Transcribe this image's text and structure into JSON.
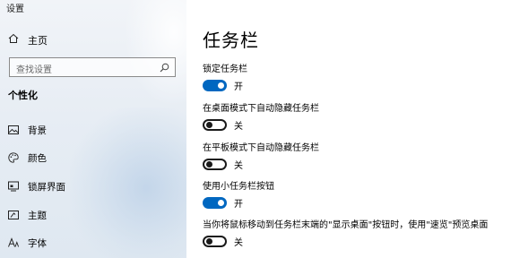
{
  "window": {
    "title": "设置"
  },
  "sidebar": {
    "home_label": "主页",
    "search_placeholder": "查找设置",
    "section_title": "个性化",
    "items": [
      {
        "label": "背景",
        "icon": "image-icon"
      },
      {
        "label": "颜色",
        "icon": "palette-icon"
      },
      {
        "label": "锁屏界面",
        "icon": "lock-screen-icon"
      },
      {
        "label": "主题",
        "icon": "theme-icon"
      },
      {
        "label": "字体",
        "icon": "font-icon"
      }
    ]
  },
  "main": {
    "title": "任务栏",
    "settings": [
      {
        "label": "锁定任务栏",
        "state": "开",
        "on": true
      },
      {
        "label": "在桌面模式下自动隐藏任务栏",
        "state": "关",
        "on": false
      },
      {
        "label": "在平板模式下自动隐藏任务栏",
        "state": "关",
        "on": false
      },
      {
        "label": "使用小任务栏按钮",
        "state": "开",
        "on": true
      },
      {
        "label": "当你将鼠标移动到任务栏末端的\"显示桌面\"按钮时，使用\"速览\"预览桌面",
        "state": "关",
        "on": false
      }
    ]
  },
  "colors": {
    "accent": "#0067c0"
  }
}
